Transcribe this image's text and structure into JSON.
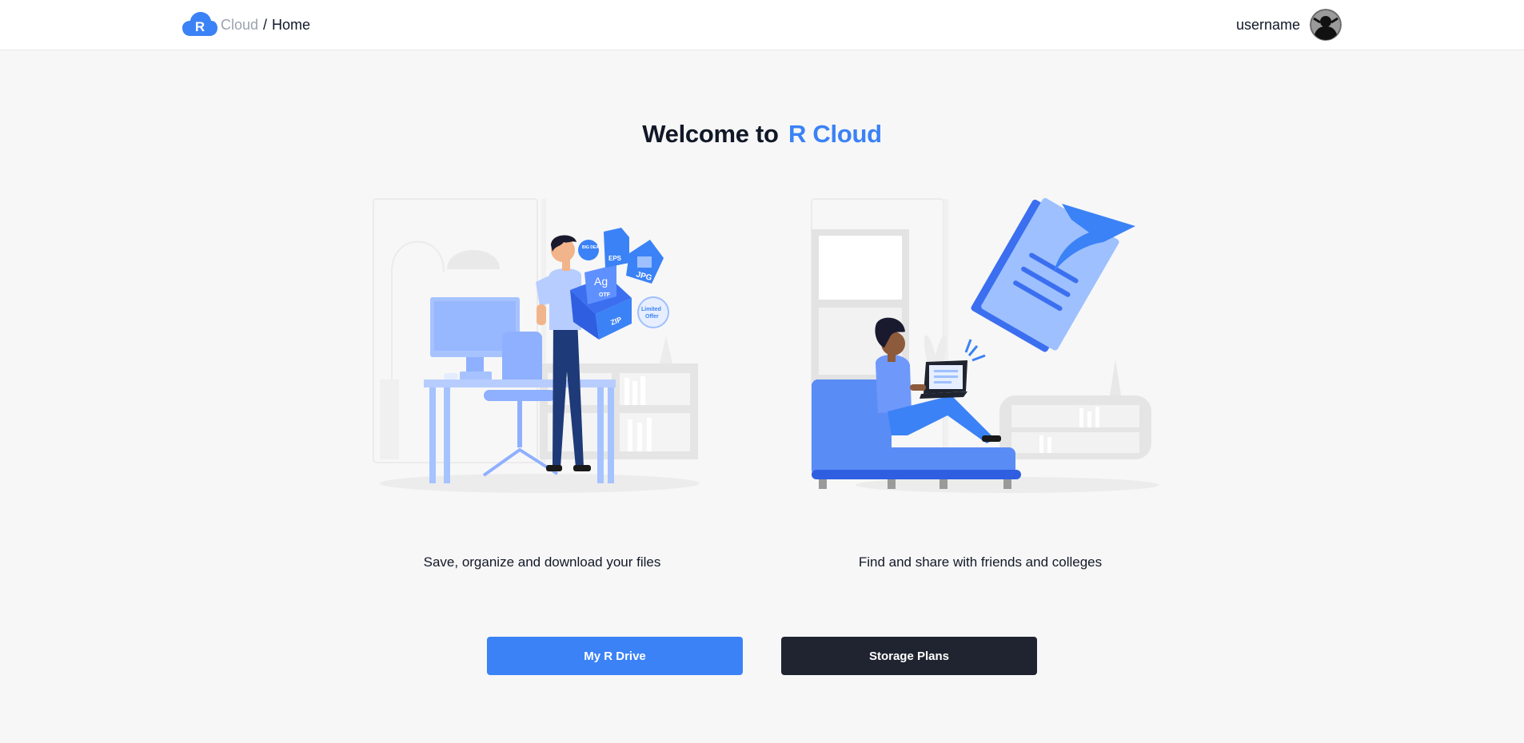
{
  "header": {
    "logo_letter": "R",
    "breadcrumb": {
      "root": "Cloud",
      "separator": "/",
      "current": "Home"
    },
    "username": "username",
    "avatar_icon": "user-avatar-icon"
  },
  "hero": {
    "title_prefix": "Welcome to",
    "title_brand": "R Cloud"
  },
  "features": [
    {
      "caption": "Save, organize and download your files",
      "illustration": "man-holding-box-illustration"
    },
    {
      "caption": "Find and share with friends and colleges",
      "illustration": "woman-with-laptop-sharing-illustration"
    }
  ],
  "illustration_text": {
    "badge_big_deal": "BIG DEAL",
    "file_eps": "EPS",
    "file_jpg": "JPG",
    "box_ag": "Ag",
    "box_otf": "OTF",
    "box_zip": "ZIP",
    "badge_limited": "Limited",
    "badge_offer": "Offer"
  },
  "actions": {
    "my_drive": "My R Drive",
    "storage_plans": "Storage Plans"
  },
  "colors": {
    "accent": "#3b82f6",
    "dark": "#1f2430",
    "background": "#f7f7f7"
  }
}
